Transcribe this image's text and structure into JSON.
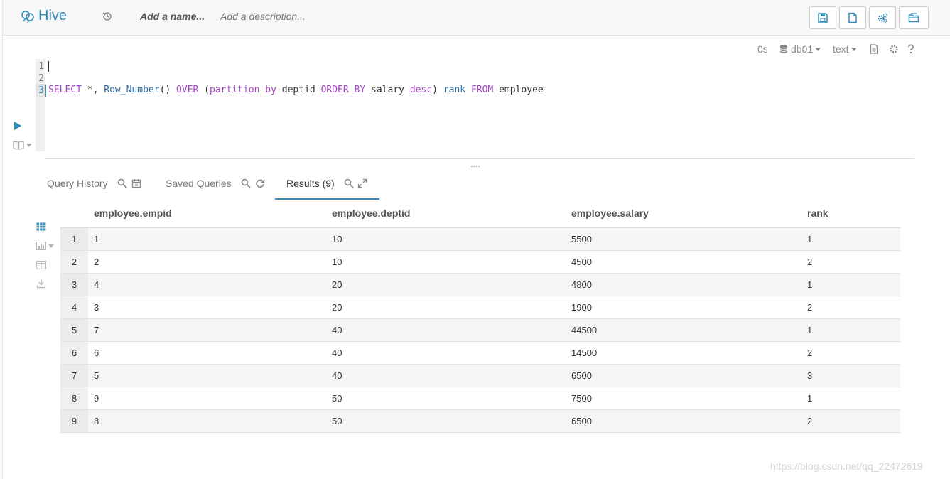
{
  "app": {
    "name": "Hive"
  },
  "header": {
    "name_placeholder": "Add a name...",
    "description_placeholder": "Add a description..."
  },
  "editor_toolbar": {
    "elapsed": "0s",
    "database": "db01",
    "format": "text"
  },
  "editor": {
    "line_numbers": [
      "1",
      "2",
      "3"
    ],
    "query_parts": {
      "p1": "SELECT",
      "p2": " *, ",
      "p3": "Row_Number",
      "p4": "() ",
      "p5": "OVER",
      "p6": " (",
      "p7": "partition",
      "p8": " ",
      "p9": "by",
      "p10": " deptid ",
      "p11": "ORDER",
      "p12": " ",
      "p13": "BY",
      "p14": " salary ",
      "p15": "desc",
      "p16": ") ",
      "p17": "rank",
      "p18": " ",
      "p19": "FROM",
      "p20": " employee"
    }
  },
  "tabs": [
    {
      "label": "Query History"
    },
    {
      "label": "Saved Queries"
    },
    {
      "label": "Results (9)"
    }
  ],
  "results": {
    "columns": [
      "employee.empid",
      "employee.deptid",
      "employee.salary",
      "rank"
    ],
    "rows": [
      {
        "n": "1",
        "empid": "1",
        "deptid": "10",
        "salary": "5500",
        "rank": "1"
      },
      {
        "n": "2",
        "empid": "2",
        "deptid": "10",
        "salary": "4500",
        "rank": "2"
      },
      {
        "n": "3",
        "empid": "4",
        "deptid": "20",
        "salary": "4800",
        "rank": "1"
      },
      {
        "n": "4",
        "empid": "3",
        "deptid": "20",
        "salary": "1900",
        "rank": "2"
      },
      {
        "n": "5",
        "empid": "7",
        "deptid": "40",
        "salary": "44500",
        "rank": "1"
      },
      {
        "n": "6",
        "empid": "6",
        "deptid": "40",
        "salary": "14500",
        "rank": "2"
      },
      {
        "n": "7",
        "empid": "5",
        "deptid": "40",
        "salary": "6500",
        "rank": "3"
      },
      {
        "n": "8",
        "empid": "9",
        "deptid": "50",
        "salary": "7500",
        "rank": "1"
      },
      {
        "n": "9",
        "empid": "8",
        "deptid": "50",
        "salary": "6500",
        "rank": "2"
      }
    ]
  },
  "watermark": "https://blog.csdn.net/qq_22472619",
  "colors": {
    "accent": "#338bb8",
    "keyword": "#a346c2",
    "function": "#2e6da4"
  }
}
